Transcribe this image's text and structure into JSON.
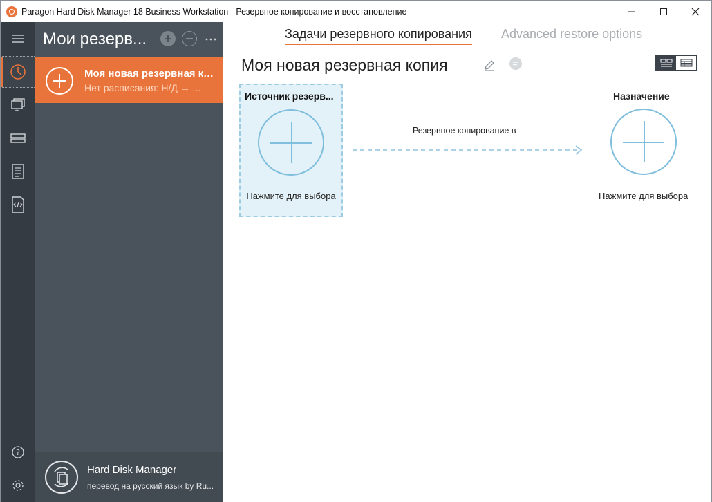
{
  "window": {
    "title": "Paragon Hard Disk Manager 18 Business Workstation - Резервное копирование и восстановление"
  },
  "rail": {
    "items": [
      "clock-icon",
      "monitors-icon",
      "disks-icon",
      "list-icon",
      "script-icon"
    ],
    "bottom_items": [
      "help-icon",
      "settings-icon"
    ]
  },
  "panel": {
    "title": "Мои резерв...",
    "backup_item": {
      "name": "Моя новая резервная ко...",
      "schedule": "Нет расписания: Н/Д → ..."
    },
    "footer": {
      "app_name": "Hard Disk Manager",
      "credit": "перевод на русский язык by Ru..."
    }
  },
  "tabs": {
    "active": "Задачи резервного копирования",
    "inactive": "Advanced restore options"
  },
  "main": {
    "title": "Моя новая резервная копия",
    "source": {
      "title": "Источник резерв...",
      "hint": "Нажмите для выбора"
    },
    "arrow_label": "Резервное копирование в",
    "destination": {
      "title": "Назначение",
      "hint": "Нажмите для выбора"
    }
  },
  "colors": {
    "accent": "#e8743b",
    "rail_bg": "#353b42",
    "panel_bg": "#4a535b",
    "source_bg": "#e3f1f8",
    "plus_blue": "#7fbedc"
  }
}
